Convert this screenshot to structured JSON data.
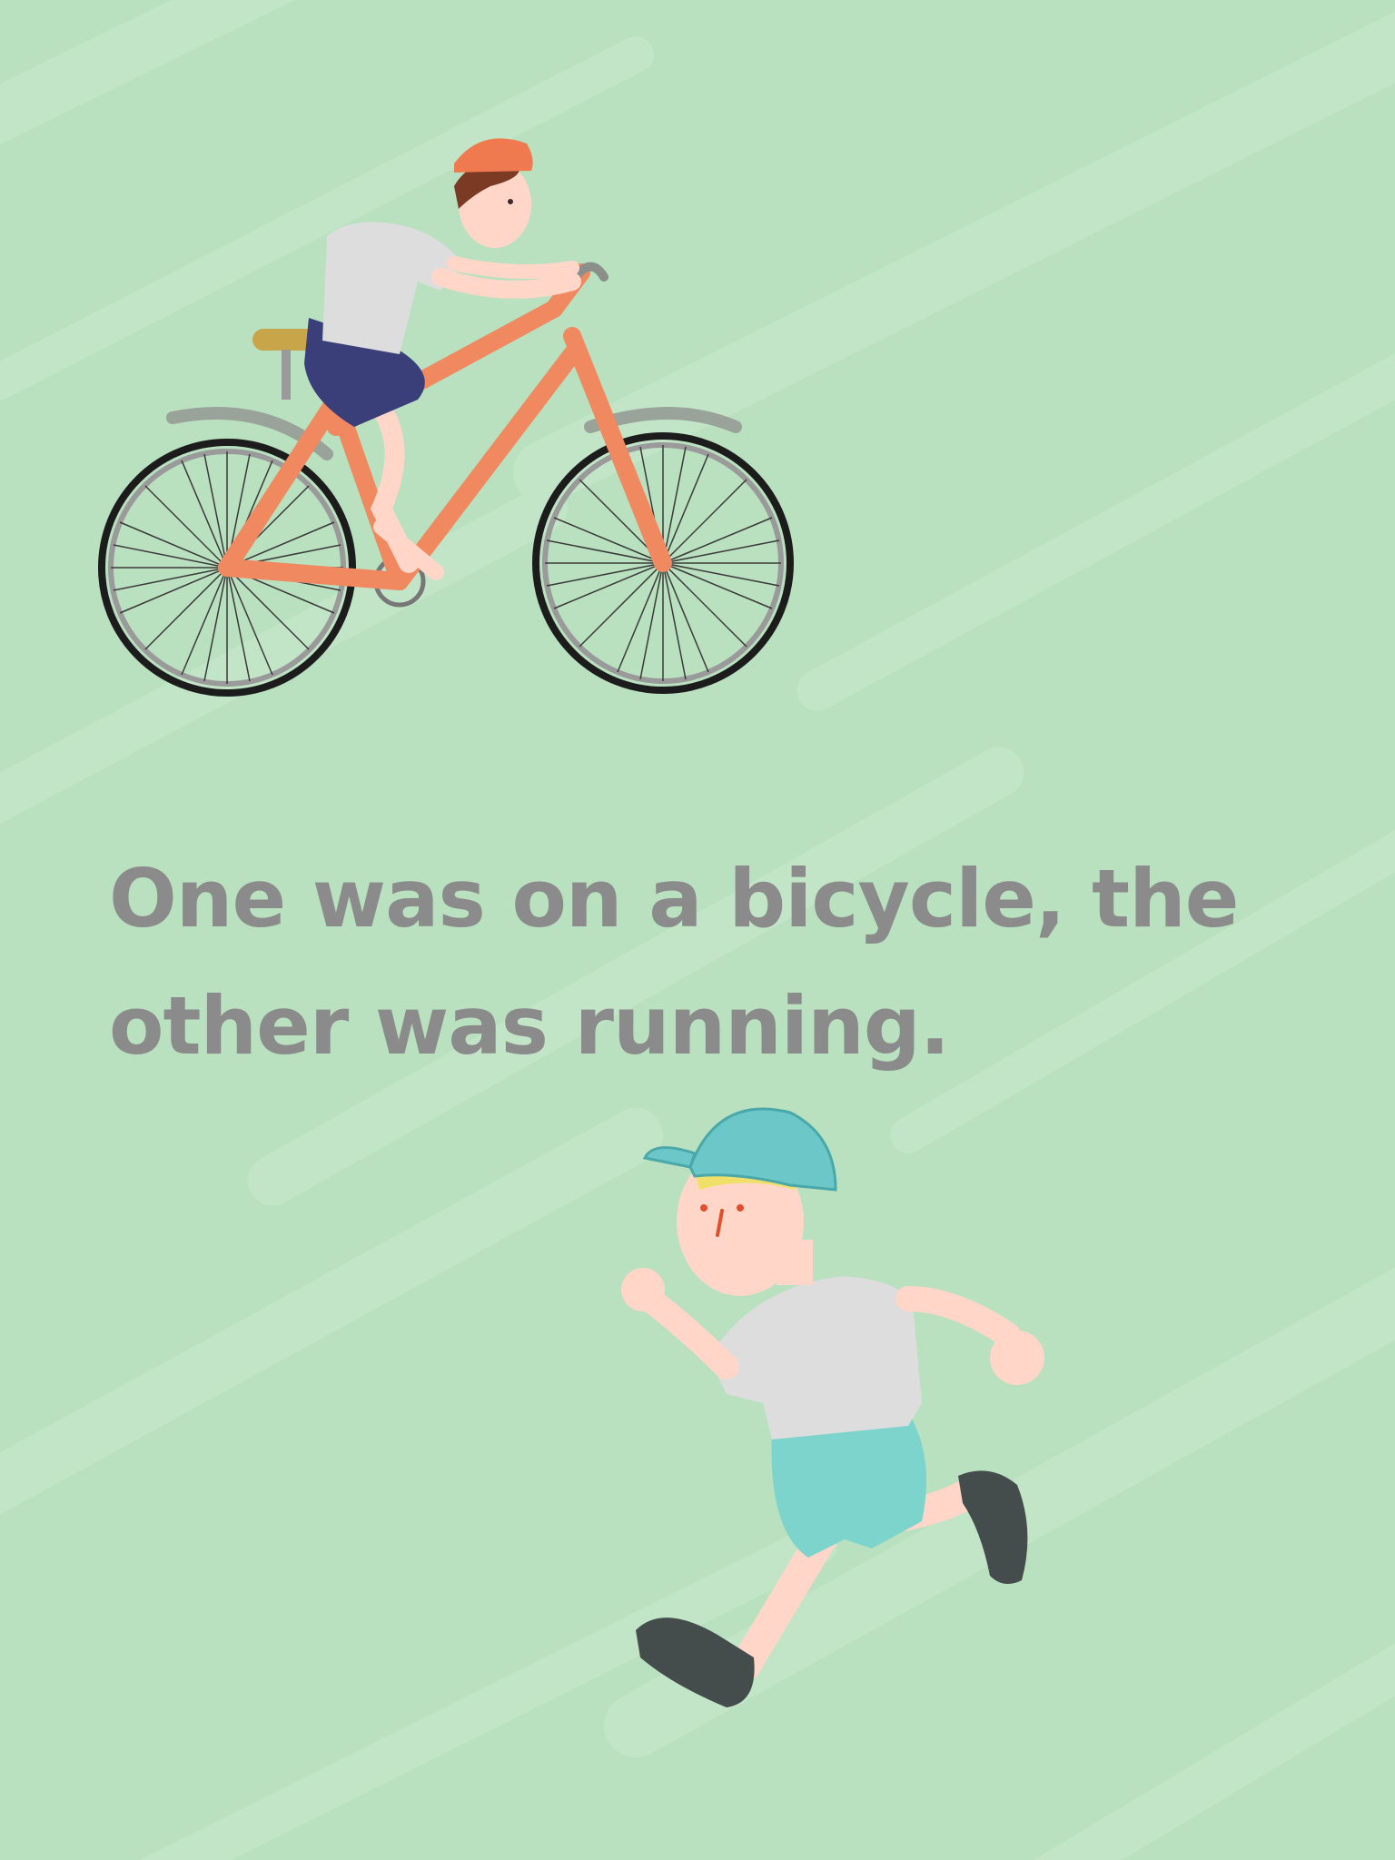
{
  "page": {
    "background_color": "#b9e0bf",
    "caption": "One was on a bicycle, the other was running.",
    "caption_color": "#8b8b8b"
  },
  "illustrations": {
    "cyclist": {
      "icon": "child-riding-bicycle",
      "bicycle_color": "#f08860",
      "helmet_color": "#f07a50",
      "shorts_color": "#3a3f7a"
    },
    "runner": {
      "icon": "child-running",
      "cap_color": "#6cc8c8",
      "shorts_color": "#7cd4cc",
      "shoe_color": "#444c4c"
    }
  }
}
